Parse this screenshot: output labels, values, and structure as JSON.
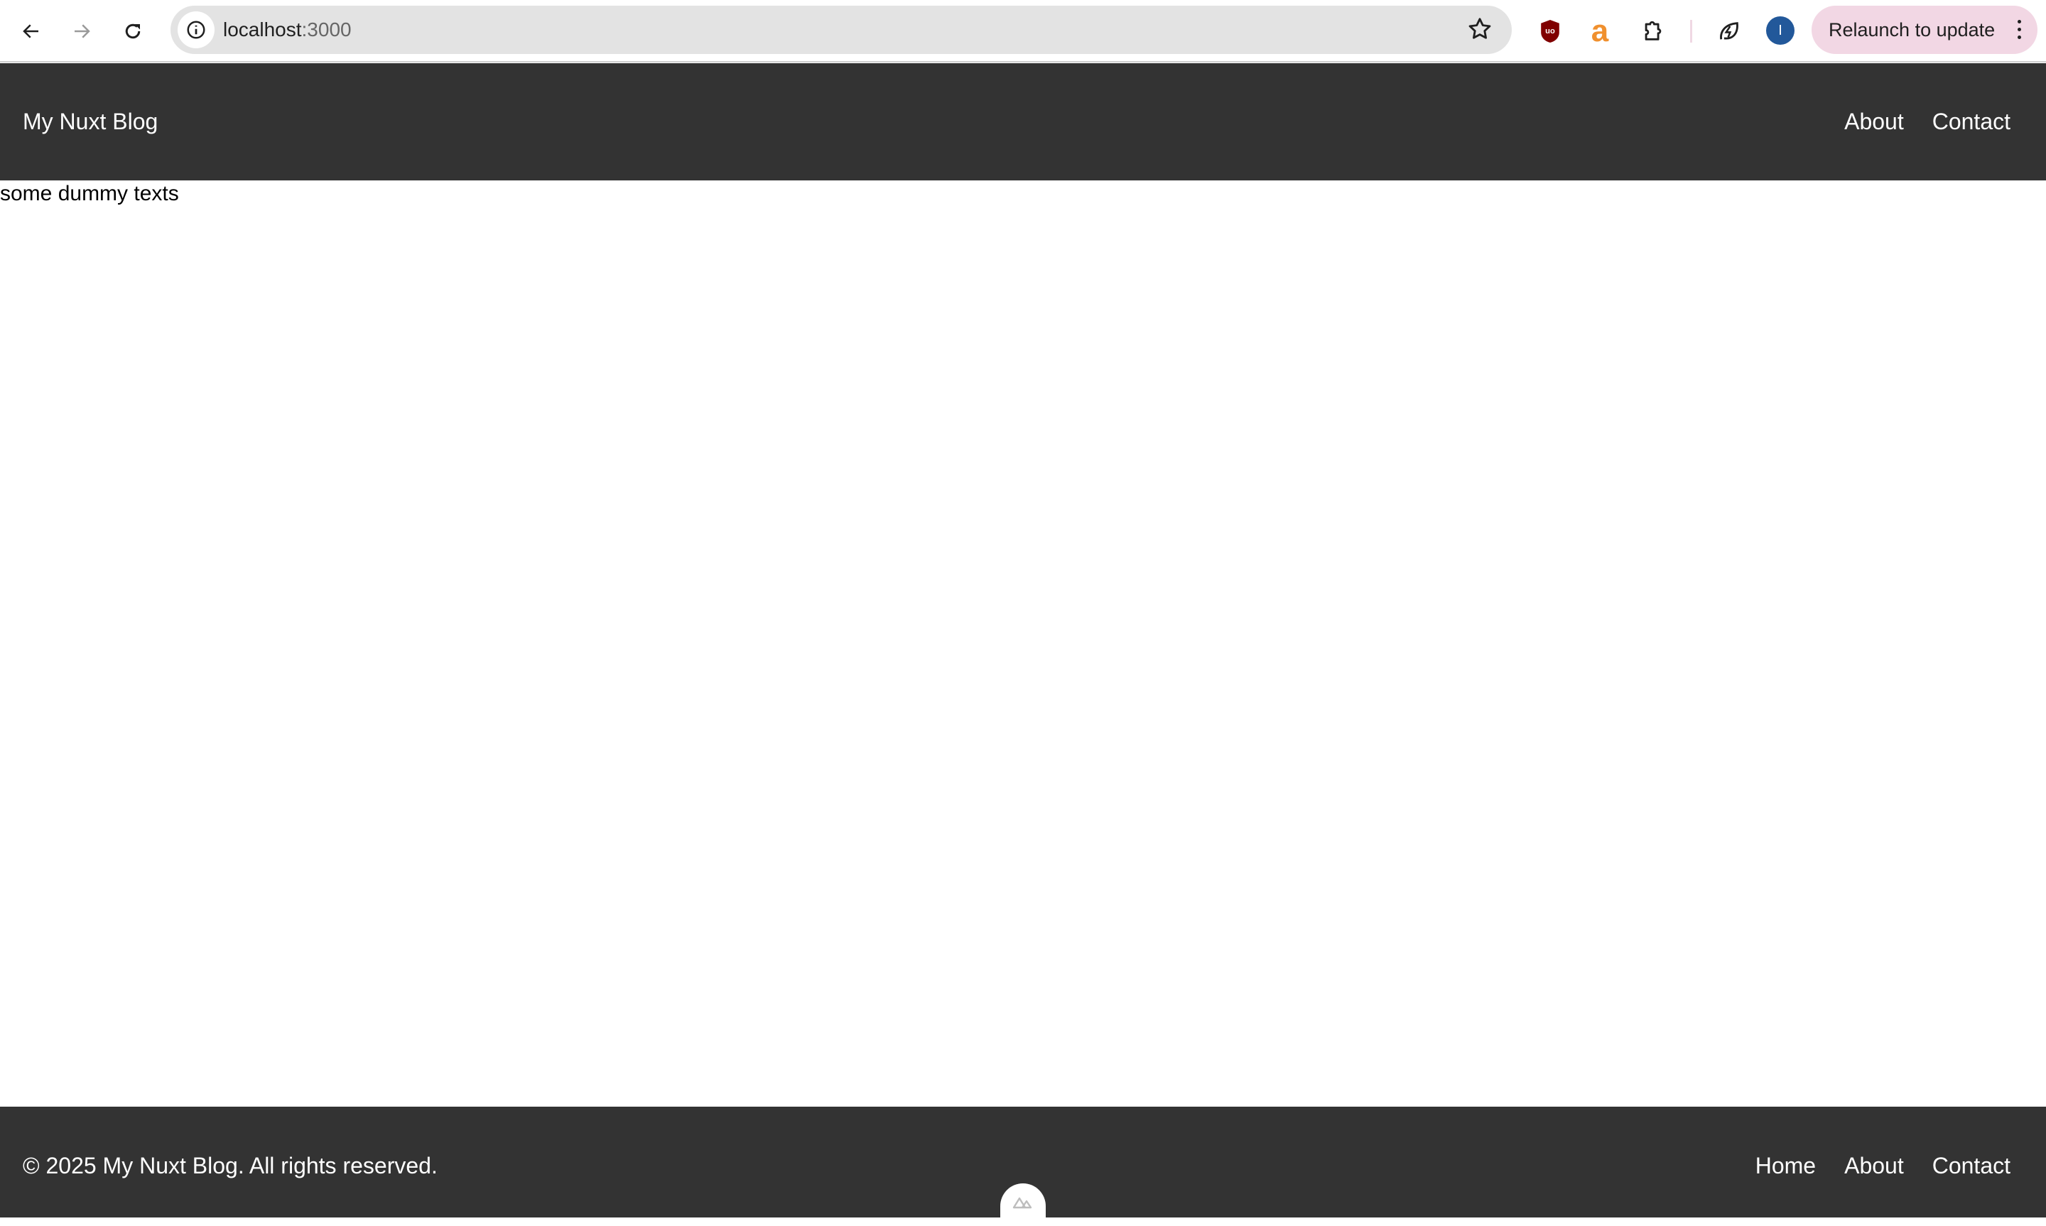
{
  "browser": {
    "url_host": "localhost",
    "url_port": ":3000",
    "relaunch_label": "Relaunch to update",
    "avatar_initial": "I",
    "extensions": [
      "ublock-origin-icon",
      "amazon-assistant-icon",
      "extensions-puzzle-icon",
      "leaf-bolt-icon"
    ]
  },
  "header": {
    "brand": "My Nuxt Blog",
    "nav": [
      {
        "label": "About"
      },
      {
        "label": "Contact"
      }
    ]
  },
  "main": {
    "text": "some dummy texts"
  },
  "footer": {
    "copyright": "© 2025 My Nuxt Blog. All rights reserved.",
    "nav": [
      {
        "label": "Home"
      },
      {
        "label": "About"
      },
      {
        "label": "Contact"
      }
    ]
  },
  "colors": {
    "header_bg": "#333333",
    "relaunch_bg": "#f2d7e4",
    "avatar": "#22589a",
    "ublock": "#800000",
    "amazon": "#f0902e"
  }
}
